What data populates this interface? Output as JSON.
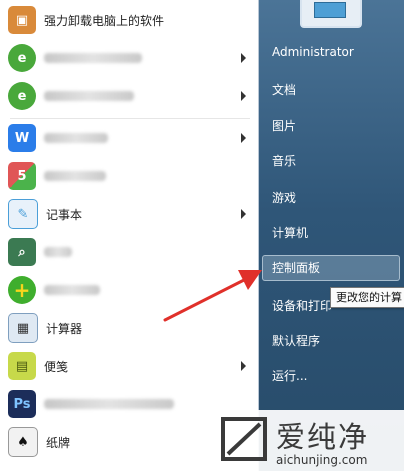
{
  "programs": [
    {
      "label": "强力卸载电脑上的软件",
      "blurred": false,
      "icon": "uninstall-box-icon",
      "color": "#d98a3a"
    },
    {
      "label": "",
      "blurred": true,
      "icon": "ie-browser-icon",
      "color": "#49a83b",
      "arrow": true
    },
    {
      "label": "",
      "blurred": true,
      "icon": "ie-browser-icon",
      "color": "#49a83b",
      "arrow": true
    },
    {
      "label": "",
      "blurred": true,
      "icon": "wps-icon",
      "color": "#2b7de9",
      "arrow": true
    },
    {
      "label": "",
      "blurred": true,
      "icon": "app-grid-icon",
      "color": "#e05656"
    },
    {
      "label": "记事本",
      "blurred": false,
      "icon": "notepad-icon",
      "color": "#4b9fd8",
      "arrow": true
    },
    {
      "label": "",
      "blurred": true,
      "icon": "magnifier-icon",
      "color": "#3b7a52"
    },
    {
      "label": "",
      "blurred": true,
      "icon": "green-plus-icon",
      "color": "#3fae2d"
    },
    {
      "label": "计算器",
      "blurred": false,
      "icon": "calculator-icon",
      "color": "#7f9fbf"
    },
    {
      "label": "便笺",
      "blurred": false,
      "icon": "sticky-notes-icon",
      "color": "#c7d94a",
      "arrow": true
    },
    {
      "label": "",
      "blurred": true,
      "icon": "photoshop-icon",
      "color": "#1c2d5a"
    },
    {
      "label": "纸牌",
      "blurred": false,
      "icon": "solitaire-icon",
      "color": "#f2f2f2"
    }
  ],
  "right_pane": {
    "links": [
      "Administrator",
      "文档",
      "图片",
      "音乐",
      "游戏",
      "计算机",
      "控制面板",
      "设备和打印",
      "默认程序",
      "运行..."
    ],
    "highlighted": "控制面板",
    "tooltip": "更改您的计算"
  },
  "watermark": {
    "title": "爱纯净",
    "url": "aichunjing.com"
  },
  "colors": {
    "right_pane": "#2f5678",
    "arrow": "#e0302a"
  }
}
